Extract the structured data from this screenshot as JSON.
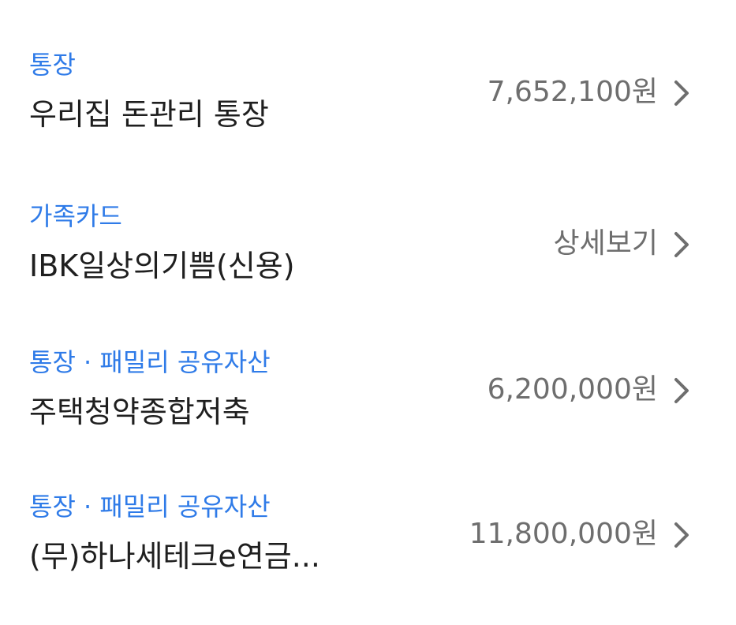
{
  "colors": {
    "category": "#2f7be8",
    "name": "#1f1f1f",
    "value": "#6e6e6e",
    "chevron": "#6e6e6e"
  },
  "items": [
    {
      "category": "통장",
      "name": "우리집 돈관리 통장",
      "value": "7,652,100원",
      "icon": "chevron-right-icon"
    },
    {
      "category": "가족카드",
      "name": "IBK일상의기쁨(신용)",
      "value": "상세보기",
      "icon": "chevron-right-icon"
    },
    {
      "category": "통장 · 패밀리 공유자산",
      "name": "주택청약종합저축",
      "value": "6,200,000원",
      "icon": "chevron-right-icon"
    },
    {
      "category": "통장 · 패밀리 공유자산",
      "name": "(무)하나세테크e연금...",
      "value": "11,800,000원",
      "icon": "chevron-right-icon"
    }
  ]
}
